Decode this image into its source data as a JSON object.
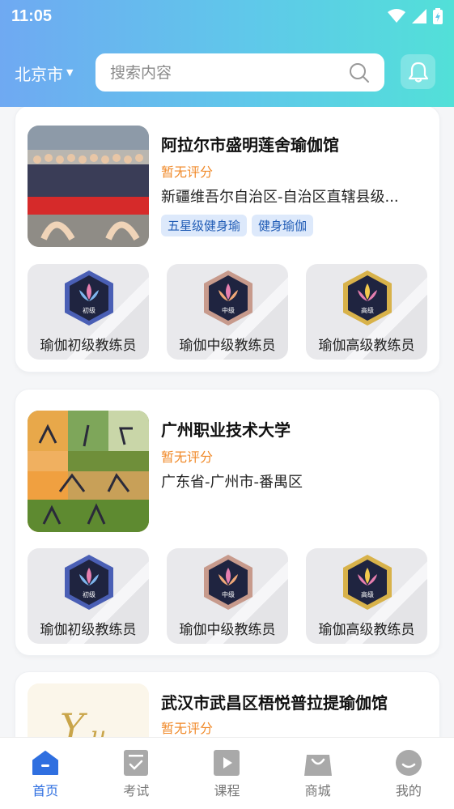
{
  "status": {
    "time": "11:05"
  },
  "header": {
    "city": "北京市",
    "search_placeholder": "搜索内容"
  },
  "venues": [
    {
      "name": "阿拉尔市盛明莲舍瑜伽馆",
      "rating": "暂无评分",
      "address": "新疆维吾尔自治区-自治区直辖县级...",
      "tags": [
        "五星级健身瑜",
        "健身瑜伽"
      ],
      "certs": [
        {
          "label": "瑜伽初级教练员",
          "badge_text": "初级"
        },
        {
          "label": "瑜伽中级教练员",
          "badge_text": "中级"
        },
        {
          "label": "瑜伽高级教练员",
          "badge_text": "高级"
        }
      ]
    },
    {
      "name": "广州职业技术大学",
      "rating": "暂无评分",
      "address": "广东省-广州市-番禺区",
      "tags": [],
      "certs": [
        {
          "label": "瑜伽初级教练员",
          "badge_text": "初级"
        },
        {
          "label": "瑜伽中级教练员",
          "badge_text": "中级"
        },
        {
          "label": "瑜伽高级教练员",
          "badge_text": "高级"
        }
      ]
    },
    {
      "name": "武汉市武昌区梧悦普拉提瑜伽馆",
      "rating": "暂无评分"
    }
  ],
  "tabbar": {
    "items": [
      {
        "label": "首页",
        "icon": "home-icon",
        "active": true
      },
      {
        "label": "考试",
        "icon": "exam-icon",
        "active": false
      },
      {
        "label": "课程",
        "icon": "course-play-icon",
        "active": false
      },
      {
        "label": "商城",
        "icon": "shop-bag-icon",
        "active": false
      },
      {
        "label": "我的",
        "icon": "profile-icon",
        "active": false
      }
    ]
  },
  "colors": {
    "accent": "#2f6fe0",
    "rating": "#f08a2a",
    "tag_bg": "#dde9fb",
    "tag_text": "#1f5bb5"
  }
}
